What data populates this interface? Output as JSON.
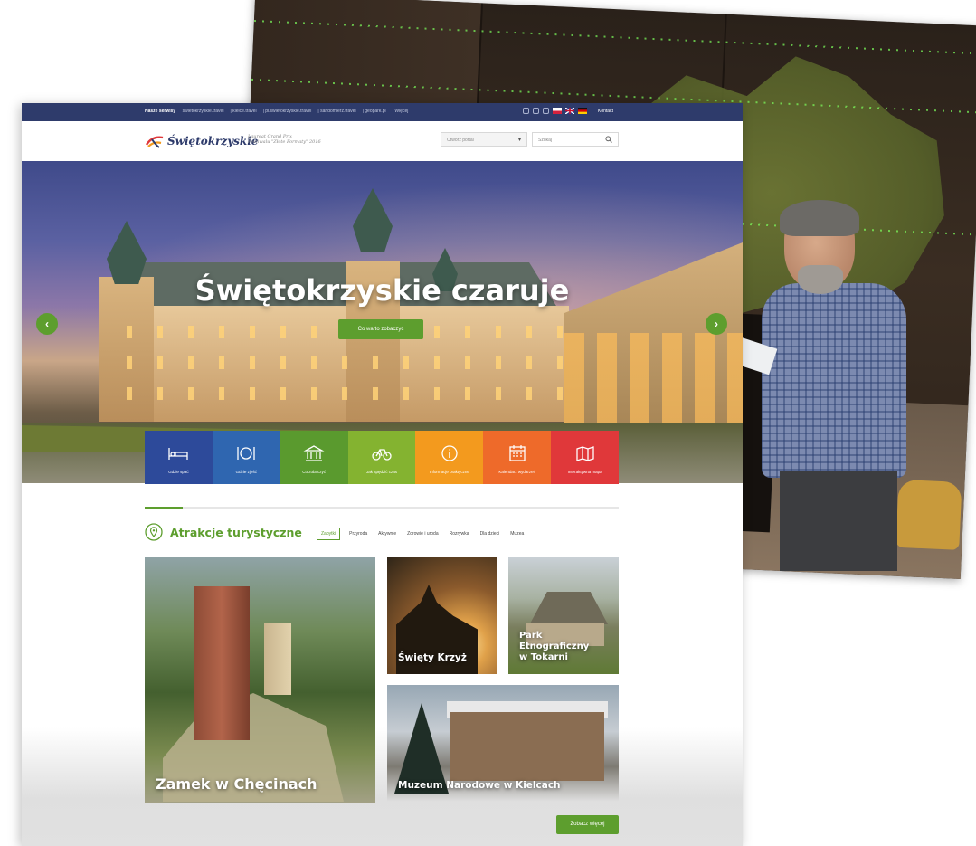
{
  "topbar": {
    "label": "Nasze serwisy",
    "links": [
      "swietokrzyskie.travel",
      "kielce.travel",
      "pl.swietokrzyskie.travel",
      "sandomierz.travel",
      "geopark.pl",
      "Więcej"
    ],
    "contact": "Kontakt",
    "color": "#2e3b6b"
  },
  "header": {
    "logo": "Świętokrzyskie",
    "award_line1": "Laureat Grand Prix",
    "award_line2": "Festiwalu \"Złote Formaty\" 2016",
    "select_placeholder": "Otwórz portal",
    "search_placeholder": "Szukaj"
  },
  "hero": {
    "title": "Świętokrzyskie czaruje",
    "button": "Co warto zobaczyć",
    "prev_icon": "chevron-left-icon",
    "next_icon": "chevron-right-icon"
  },
  "tiles": [
    {
      "label": "Gdzie spać",
      "icon": "bed-icon",
      "color": "#2d4a9a"
    },
    {
      "label": "Gdzie zjeść",
      "icon": "plate-icon",
      "color": "#2f66b0"
    },
    {
      "label": "Co zobaczyć",
      "icon": "museum-icon",
      "color": "#5a9a2e"
    },
    {
      "label": "Jak spędzić czas",
      "icon": "bike-icon",
      "color": "#84b330"
    },
    {
      "label": "Informacje praktyczne",
      "icon": "info-icon",
      "color": "#f39a1e"
    },
    {
      "label": "Kalendarz wydarzeń",
      "icon": "calendar-icon",
      "color": "#ee6a2a"
    },
    {
      "label": "Interaktywna mapa",
      "icon": "map-icon",
      "color": "#e0383a"
    }
  ],
  "attractions": {
    "title": "Atrakcje turystyczne",
    "categories": [
      "Zabytki",
      "Przyroda",
      "Aktywnie",
      "Zdrowie i uroda",
      "Rozrywka",
      "Dla dzieci",
      "Muzea"
    ],
    "active_category": "Zabytki",
    "cards": {
      "zamek": "Zamek w Chęcinach",
      "krzyz": "Święty Krzyż",
      "park": "Park Etnograficzny w Tokarni",
      "muzeum": "Muzeum Narodowe w Kielcach"
    },
    "see_more": "Zobacz więcej"
  },
  "colors": {
    "accent": "#5d9e2e",
    "navy": "#2e3b6b"
  }
}
